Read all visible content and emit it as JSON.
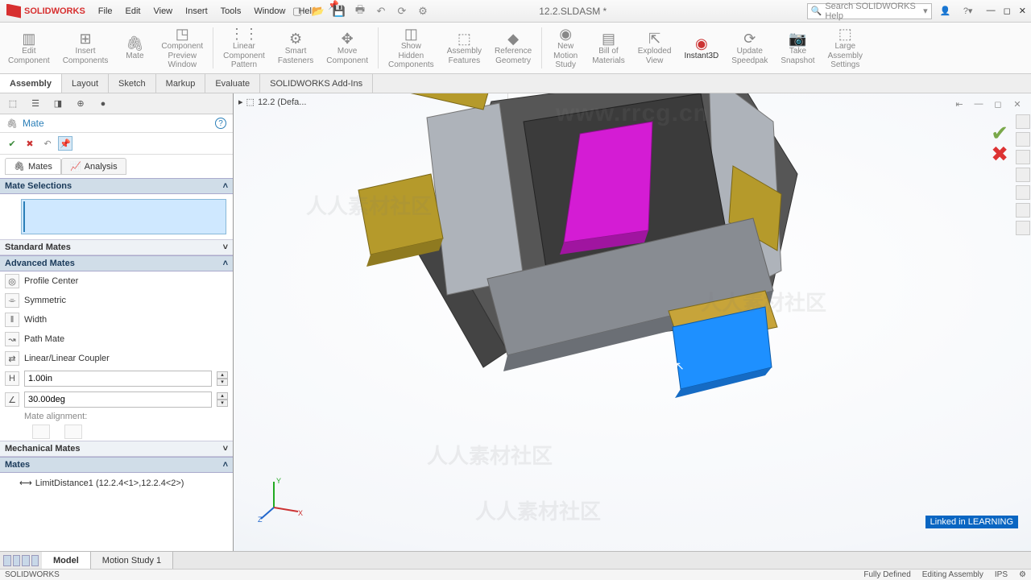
{
  "app": {
    "brand": "SOLIDWORKS",
    "doc_title": "12.2.SLDASM *"
  },
  "menus": [
    "File",
    "Edit",
    "View",
    "Insert",
    "Tools",
    "Window",
    "Help"
  ],
  "search": {
    "placeholder": "Search SOLIDWORKS Help"
  },
  "ribbon": [
    {
      "label": "Edit\nComponent"
    },
    {
      "label": "Insert\nComponents"
    },
    {
      "label": "Mate"
    },
    {
      "label": "Component\nPreview\nWindow"
    },
    {
      "label": "Linear\nComponent\nPattern"
    },
    {
      "label": "Smart\nFasteners"
    },
    {
      "label": "Move\nComponent"
    },
    {
      "label": "Show\nHidden\nComponents"
    },
    {
      "label": "Assembly\nFeatures"
    },
    {
      "label": "Reference\nGeometry"
    },
    {
      "label": "New\nMotion\nStudy"
    },
    {
      "label": "Bill of\nMaterials"
    },
    {
      "label": "Exploded\nView"
    },
    {
      "label": "Instant3D",
      "active": true
    },
    {
      "label": "Update\nSpeedpak"
    },
    {
      "label": "Take\nSnapshot"
    },
    {
      "label": "Large\nAssembly\nSettings"
    }
  ],
  "tabs": [
    "Assembly",
    "Layout",
    "Sketch",
    "Markup",
    "Evaluate",
    "SOLIDWORKS Add-Ins"
  ],
  "active_tab": "Assembly",
  "breadcrumb": "12.2  (Defa...",
  "property_manager": {
    "title": "Mate",
    "subtabs": [
      "Mates",
      "Analysis"
    ],
    "sections": {
      "mate_selections": "Mate Selections",
      "standard": "Standard Mates",
      "advanced": "Advanced Mates",
      "mechanical": "Mechanical Mates",
      "mates": "Mates"
    },
    "advanced_items": [
      "Profile Center",
      "Symmetric",
      "Width",
      "Path Mate",
      "Linear/Linear Coupler"
    ],
    "distance": "1.00in",
    "angle": "30.00deg",
    "alignment_label": "Mate alignment:",
    "mates_list": [
      "LimitDistance1 (12.2.4<1>,12.2.4<2>)"
    ]
  },
  "bottom_tabs": [
    "Model",
    "Motion Study 1"
  ],
  "status": {
    "left": "SOLIDWORKS",
    "defined": "Fully Defined",
    "mode": "Editing Assembly",
    "units": "IPS"
  },
  "watermark": {
    "url": "www.rrcg.cn",
    "text": "人人素材社区"
  },
  "linkedin": "Linked in LEARNING"
}
